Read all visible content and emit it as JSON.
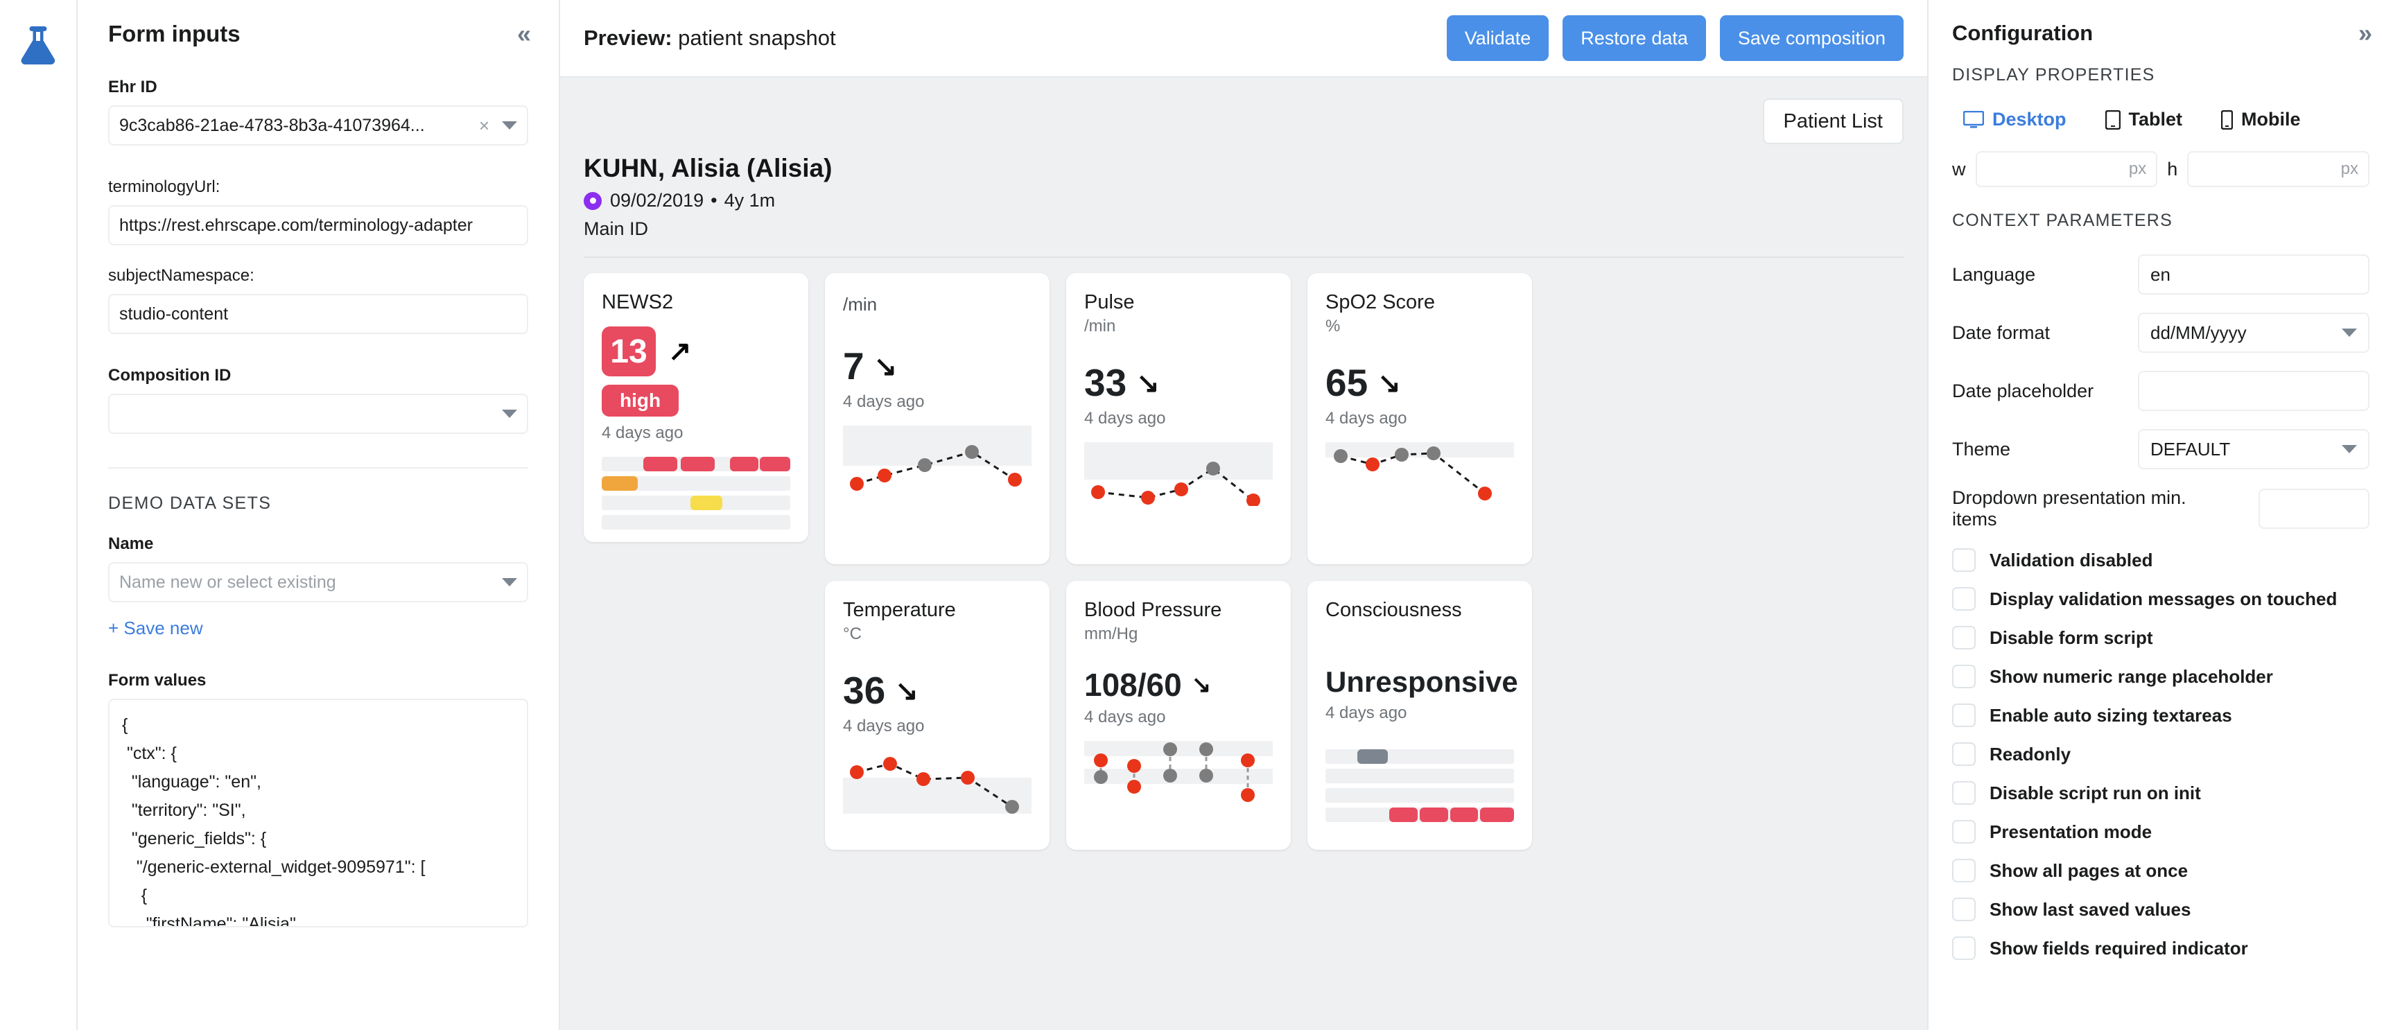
{
  "app": {
    "logo_icon": "flask-icon"
  },
  "left_panel": {
    "title": "Form inputs",
    "collapse_icon": "«",
    "ehr_id": {
      "label": "Ehr ID",
      "value": "9c3cab86-21ae-4783-8b3a-41073964...",
      "clear_icon": "×"
    },
    "terminology_url": {
      "label": "terminologyUrl:",
      "value": "https://rest.ehrscape.com/terminology-adapter"
    },
    "subject_namespace": {
      "label": "subjectNamespace:",
      "value": "studio-content"
    },
    "composition_id": {
      "label": "Composition ID",
      "value": ""
    },
    "demo_section": "DEMO DATA SETS",
    "name_field": {
      "label": "Name",
      "placeholder": "Name new or select existing"
    },
    "save_new_link": "+ Save new",
    "form_values": {
      "label": "Form values",
      "json": "{\n \"ctx\": {\n  \"language\": \"en\",\n  \"territory\": \"SI\",\n  \"generic_fields\": {\n   \"/generic-external_widget-9095971\": [\n    {\n     \"firstName\": \"Alisia\","
    }
  },
  "toolbar": {
    "preview_prefix": "Preview:",
    "preview_name": "patient snapshot",
    "validate_label": "Validate",
    "restore_label": "Restore data",
    "save_label": "Save composition"
  },
  "stage": {
    "patient_list_button": "Patient List",
    "patient": {
      "name": "KUHN, Alisia (Alisia)",
      "gender_icon": "female-icon",
      "dob": "09/02/2019",
      "separator": "•",
      "age": "4y 1m",
      "id_label": "Main ID"
    },
    "cards": [
      {
        "title": "NEWS2",
        "unit": "",
        "value": "13",
        "trend_icon": "arrow-up-right-icon",
        "trend_arrow": "↗",
        "severity": "high",
        "time": "4 days ago",
        "badge": true
      },
      {
        "title": "",
        "unit": "/min",
        "value": "7",
        "trend_icon": "arrow-down-right-icon",
        "trend_arrow": "↘",
        "time": "4 days ago"
      },
      {
        "title": "Pulse",
        "unit": "/min",
        "value": "33",
        "trend_icon": "arrow-down-right-icon",
        "trend_arrow": "↘",
        "time": "4 days ago"
      },
      {
        "title": "SpO2 Score",
        "unit": "%",
        "value": "65",
        "trend_icon": "arrow-down-right-icon",
        "trend_arrow": "↘",
        "time": "4 days ago"
      },
      {
        "title": "Temperature",
        "unit": "°C",
        "value": "36",
        "trend_icon": "arrow-down-right-icon",
        "trend_arrow": "↘",
        "time": "4 days ago"
      },
      {
        "title": "Blood Pressure",
        "unit": "mm/Hg",
        "value": "108/60",
        "trend_icon": "arrow-down-right-icon",
        "trend_arrow": "↘",
        "time": "4 days ago"
      },
      {
        "title": "Consciousness",
        "unit": "",
        "value": "Unresponsive",
        "trend_icon": "",
        "trend_arrow": "",
        "time": "4 days ago"
      }
    ]
  },
  "right_panel": {
    "title": "Configuration",
    "expand_icon": "»",
    "display_properties_caption": "DISPLAY PROPERTIES",
    "devices": [
      {
        "label": "Desktop",
        "icon": "monitor-icon",
        "active": true
      },
      {
        "label": "Tablet",
        "icon": "tablet-icon",
        "active": false
      },
      {
        "label": "Mobile",
        "icon": "mobile-icon",
        "active": false
      }
    ],
    "width": {
      "label": "w",
      "value": "",
      "unit": "px"
    },
    "height": {
      "label": "h",
      "value": "",
      "unit": "px"
    },
    "context_parameters_caption": "CONTEXT PARAMETERS",
    "params": [
      {
        "label": "Language",
        "value": "en",
        "type": "text"
      },
      {
        "label": "Date format",
        "value": "dd/MM/yyyy",
        "type": "select"
      },
      {
        "label": "Date placeholder",
        "value": "",
        "type": "text"
      },
      {
        "label": "Theme",
        "value": "DEFAULT",
        "type": "select"
      },
      {
        "label": "Dropdown presentation min. items",
        "value": "",
        "type": "number"
      }
    ],
    "checkboxes": [
      {
        "label": "Validation disabled",
        "checked": false
      },
      {
        "label": "Display validation messages on touched",
        "checked": false
      },
      {
        "label": "Disable form script",
        "checked": false
      },
      {
        "label": "Show numeric range placeholder",
        "checked": false
      },
      {
        "label": "Enable auto sizing textareas",
        "checked": false
      },
      {
        "label": "Readonly",
        "checked": false
      },
      {
        "label": "Disable script run on init",
        "checked": false
      },
      {
        "label": "Presentation mode",
        "checked": false
      },
      {
        "label": "Show all pages at once",
        "checked": false
      },
      {
        "label": "Show last saved values",
        "checked": false
      },
      {
        "label": "Show fields required indicator",
        "checked": false
      }
    ]
  },
  "chart_data": [
    {
      "type": "bar",
      "title": "NEWS2 severity bands",
      "card": "NEWS2",
      "rows": 4,
      "points": 5,
      "series": [
        {
          "name": "red-band",
          "row": 0,
          "color": "#e84a5f",
          "segments": [
            1,
            2,
            4,
            5
          ]
        },
        {
          "name": "orange-band",
          "row": 1,
          "color": "#f0a63c",
          "segments": [
            0
          ]
        },
        {
          "name": "yellow-band",
          "row": 2,
          "color": "#f7dd4c",
          "segments": [
            3
          ]
        },
        {
          "name": "empty-band",
          "row": 3,
          "color": "#eff0f2",
          "segments": []
        }
      ]
    },
    {
      "type": "line",
      "title": "Respiration rate trend",
      "card": "/min",
      "x": [
        1,
        2,
        3,
        4,
        5
      ],
      "values": [
        8,
        28,
        52,
        78,
        10
      ],
      "point_colors": [
        "#e8351a",
        "#e8351a",
        "#7d7d7d",
        "#7d7d7d",
        "#e8351a"
      ],
      "normal_band": [
        42,
        100
      ]
    },
    {
      "type": "line",
      "title": "Pulse trend",
      "card": "Pulse",
      "x": [
        1,
        2,
        3,
        4,
        5
      ],
      "values": [
        18,
        10,
        26,
        80,
        4
      ],
      "point_colors": [
        "#e8351a",
        "#e8351a",
        "#e8351a",
        "#7d7d7d",
        "#e8351a"
      ],
      "normal_band": [
        30,
        100
      ]
    },
    {
      "type": "line",
      "title": "SpO2 trend",
      "card": "SpO2 Score",
      "x": [
        1,
        2,
        3,
        4,
        5
      ],
      "values": [
        72,
        62,
        78,
        80,
        8
      ],
      "point_colors": [
        "#7d7d7d",
        "#e8351a",
        "#7d7d7d",
        "#7d7d7d",
        "#e8351a"
      ],
      "normal_band": [
        66,
        100
      ]
    },
    {
      "type": "line",
      "title": "Temperature trend",
      "card": "Temperature",
      "x": [
        1,
        2,
        3,
        4,
        5
      ],
      "values": [
        74,
        84,
        66,
        68,
        12
      ],
      "point_colors": [
        "#e8351a",
        "#e8351a",
        "#e8351a",
        "#e8351a",
        "#7d7d7d"
      ],
      "normal_band": [
        0,
        62
      ]
    },
    {
      "type": "scatter",
      "title": "Blood pressure systolic / diastolic",
      "card": "Blood Pressure",
      "x": [
        1,
        2,
        3,
        4,
        5
      ],
      "systolic": [
        68,
        58,
        86,
        86,
        72
      ],
      "diastolic": [
        48,
        30,
        48,
        48,
        12
      ],
      "systolic_colors": [
        "#e8351a",
        "#e8351a",
        "#7d7d7d",
        "#7d7d7d",
        "#e8351a"
      ],
      "diastolic_colors": [
        "#7d7d7d",
        "#e8351a",
        "#7d7d7d",
        "#7d7d7d",
        "#e8351a"
      ],
      "normal_bands": [
        [
          72,
          94
        ],
        [
          40,
          58
        ]
      ]
    },
    {
      "type": "bar",
      "title": "Consciousness bands",
      "card": "Consciousness",
      "rows": 4,
      "points": 5,
      "series": [
        {
          "name": "grey-band",
          "row": 0,
          "color": "#7d8590",
          "segments": [
            1
          ]
        },
        {
          "name": "empty-band-1",
          "row": 1,
          "color": "#eff0f2",
          "segments": []
        },
        {
          "name": "empty-band-2",
          "row": 2,
          "color": "#eff0f2",
          "segments": []
        },
        {
          "name": "red-band",
          "row": 3,
          "color": "#e84a5f",
          "segments": [
            2,
            3,
            4,
            5
          ]
        }
      ]
    }
  ]
}
